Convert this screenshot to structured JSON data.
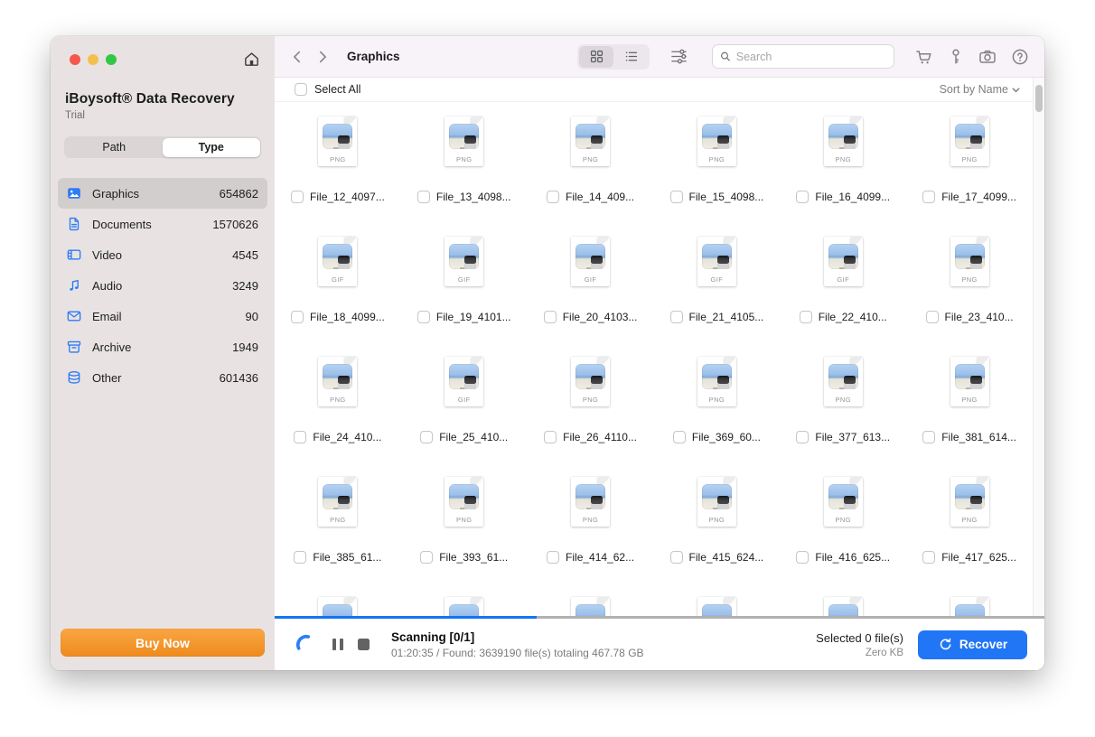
{
  "window": {
    "title": "iBoysoft® Data Recovery",
    "subtitle": "Trial"
  },
  "sidebar": {
    "tabs": [
      {
        "label": "Path",
        "active": false
      },
      {
        "label": "Type",
        "active": true
      }
    ],
    "categories": [
      {
        "icon": "graphics-icon",
        "label": "Graphics",
        "count": "654862",
        "selected": true
      },
      {
        "icon": "documents-icon",
        "label": "Documents",
        "count": "1570626",
        "selected": false
      },
      {
        "icon": "video-icon",
        "label": "Video",
        "count": "4545",
        "selected": false
      },
      {
        "icon": "audio-icon",
        "label": "Audio",
        "count": "3249",
        "selected": false
      },
      {
        "icon": "email-icon",
        "label": "Email",
        "count": "90",
        "selected": false
      },
      {
        "icon": "archive-icon",
        "label": "Archive",
        "count": "1949",
        "selected": false
      },
      {
        "icon": "other-icon",
        "label": "Other",
        "count": "601436",
        "selected": false
      }
    ],
    "buy_button": "Buy Now"
  },
  "toolbar": {
    "title": "Graphics",
    "search_placeholder": "Search"
  },
  "listbar": {
    "select_all": "Select All",
    "sort": "Sort by Name"
  },
  "files": [
    {
      "name": "File_12_4097...",
      "type": "PNG"
    },
    {
      "name": "File_13_4098...",
      "type": "PNG"
    },
    {
      "name": "File_14_409...",
      "type": "PNG"
    },
    {
      "name": "File_15_4098...",
      "type": "PNG"
    },
    {
      "name": "File_16_4099...",
      "type": "PNG"
    },
    {
      "name": "File_17_4099...",
      "type": "PNG"
    },
    {
      "name": "File_18_4099...",
      "type": "GIF"
    },
    {
      "name": "File_19_4101...",
      "type": "GIF"
    },
    {
      "name": "File_20_4103...",
      "type": "GIF"
    },
    {
      "name": "File_21_4105...",
      "type": "GIF"
    },
    {
      "name": "File_22_410...",
      "type": "GIF"
    },
    {
      "name": "File_23_410...",
      "type": "PNG"
    },
    {
      "name": "File_24_410...",
      "type": "PNG"
    },
    {
      "name": "File_25_410...",
      "type": "GIF"
    },
    {
      "name": "File_26_4110...",
      "type": "PNG"
    },
    {
      "name": "File_369_60...",
      "type": "PNG"
    },
    {
      "name": "File_377_613...",
      "type": "PNG"
    },
    {
      "name": "File_381_614...",
      "type": "PNG"
    },
    {
      "name": "File_385_61...",
      "type": "PNG"
    },
    {
      "name": "File_393_61...",
      "type": "PNG"
    },
    {
      "name": "File_414_62...",
      "type": "PNG"
    },
    {
      "name": "File_415_624...",
      "type": "PNG"
    },
    {
      "name": "File_416_625...",
      "type": "PNG"
    },
    {
      "name": "File_417_625...",
      "type": "PNG"
    }
  ],
  "partial_row_count": 6,
  "statusbar": {
    "scanning": "Scanning [0/1]",
    "details": "01:20:35 / Found: 3639190 file(s) totaling 467.78 GB",
    "selected": "Selected 0 file(s)",
    "selected_size": "Zero KB",
    "recover": "Recover",
    "progress_percent": 34
  },
  "colors": {
    "accent_blue": "#2e7bf5",
    "buy_orange": "#f7941e",
    "progress_blue": "#1374f4",
    "recover_blue": "#2176f5"
  }
}
